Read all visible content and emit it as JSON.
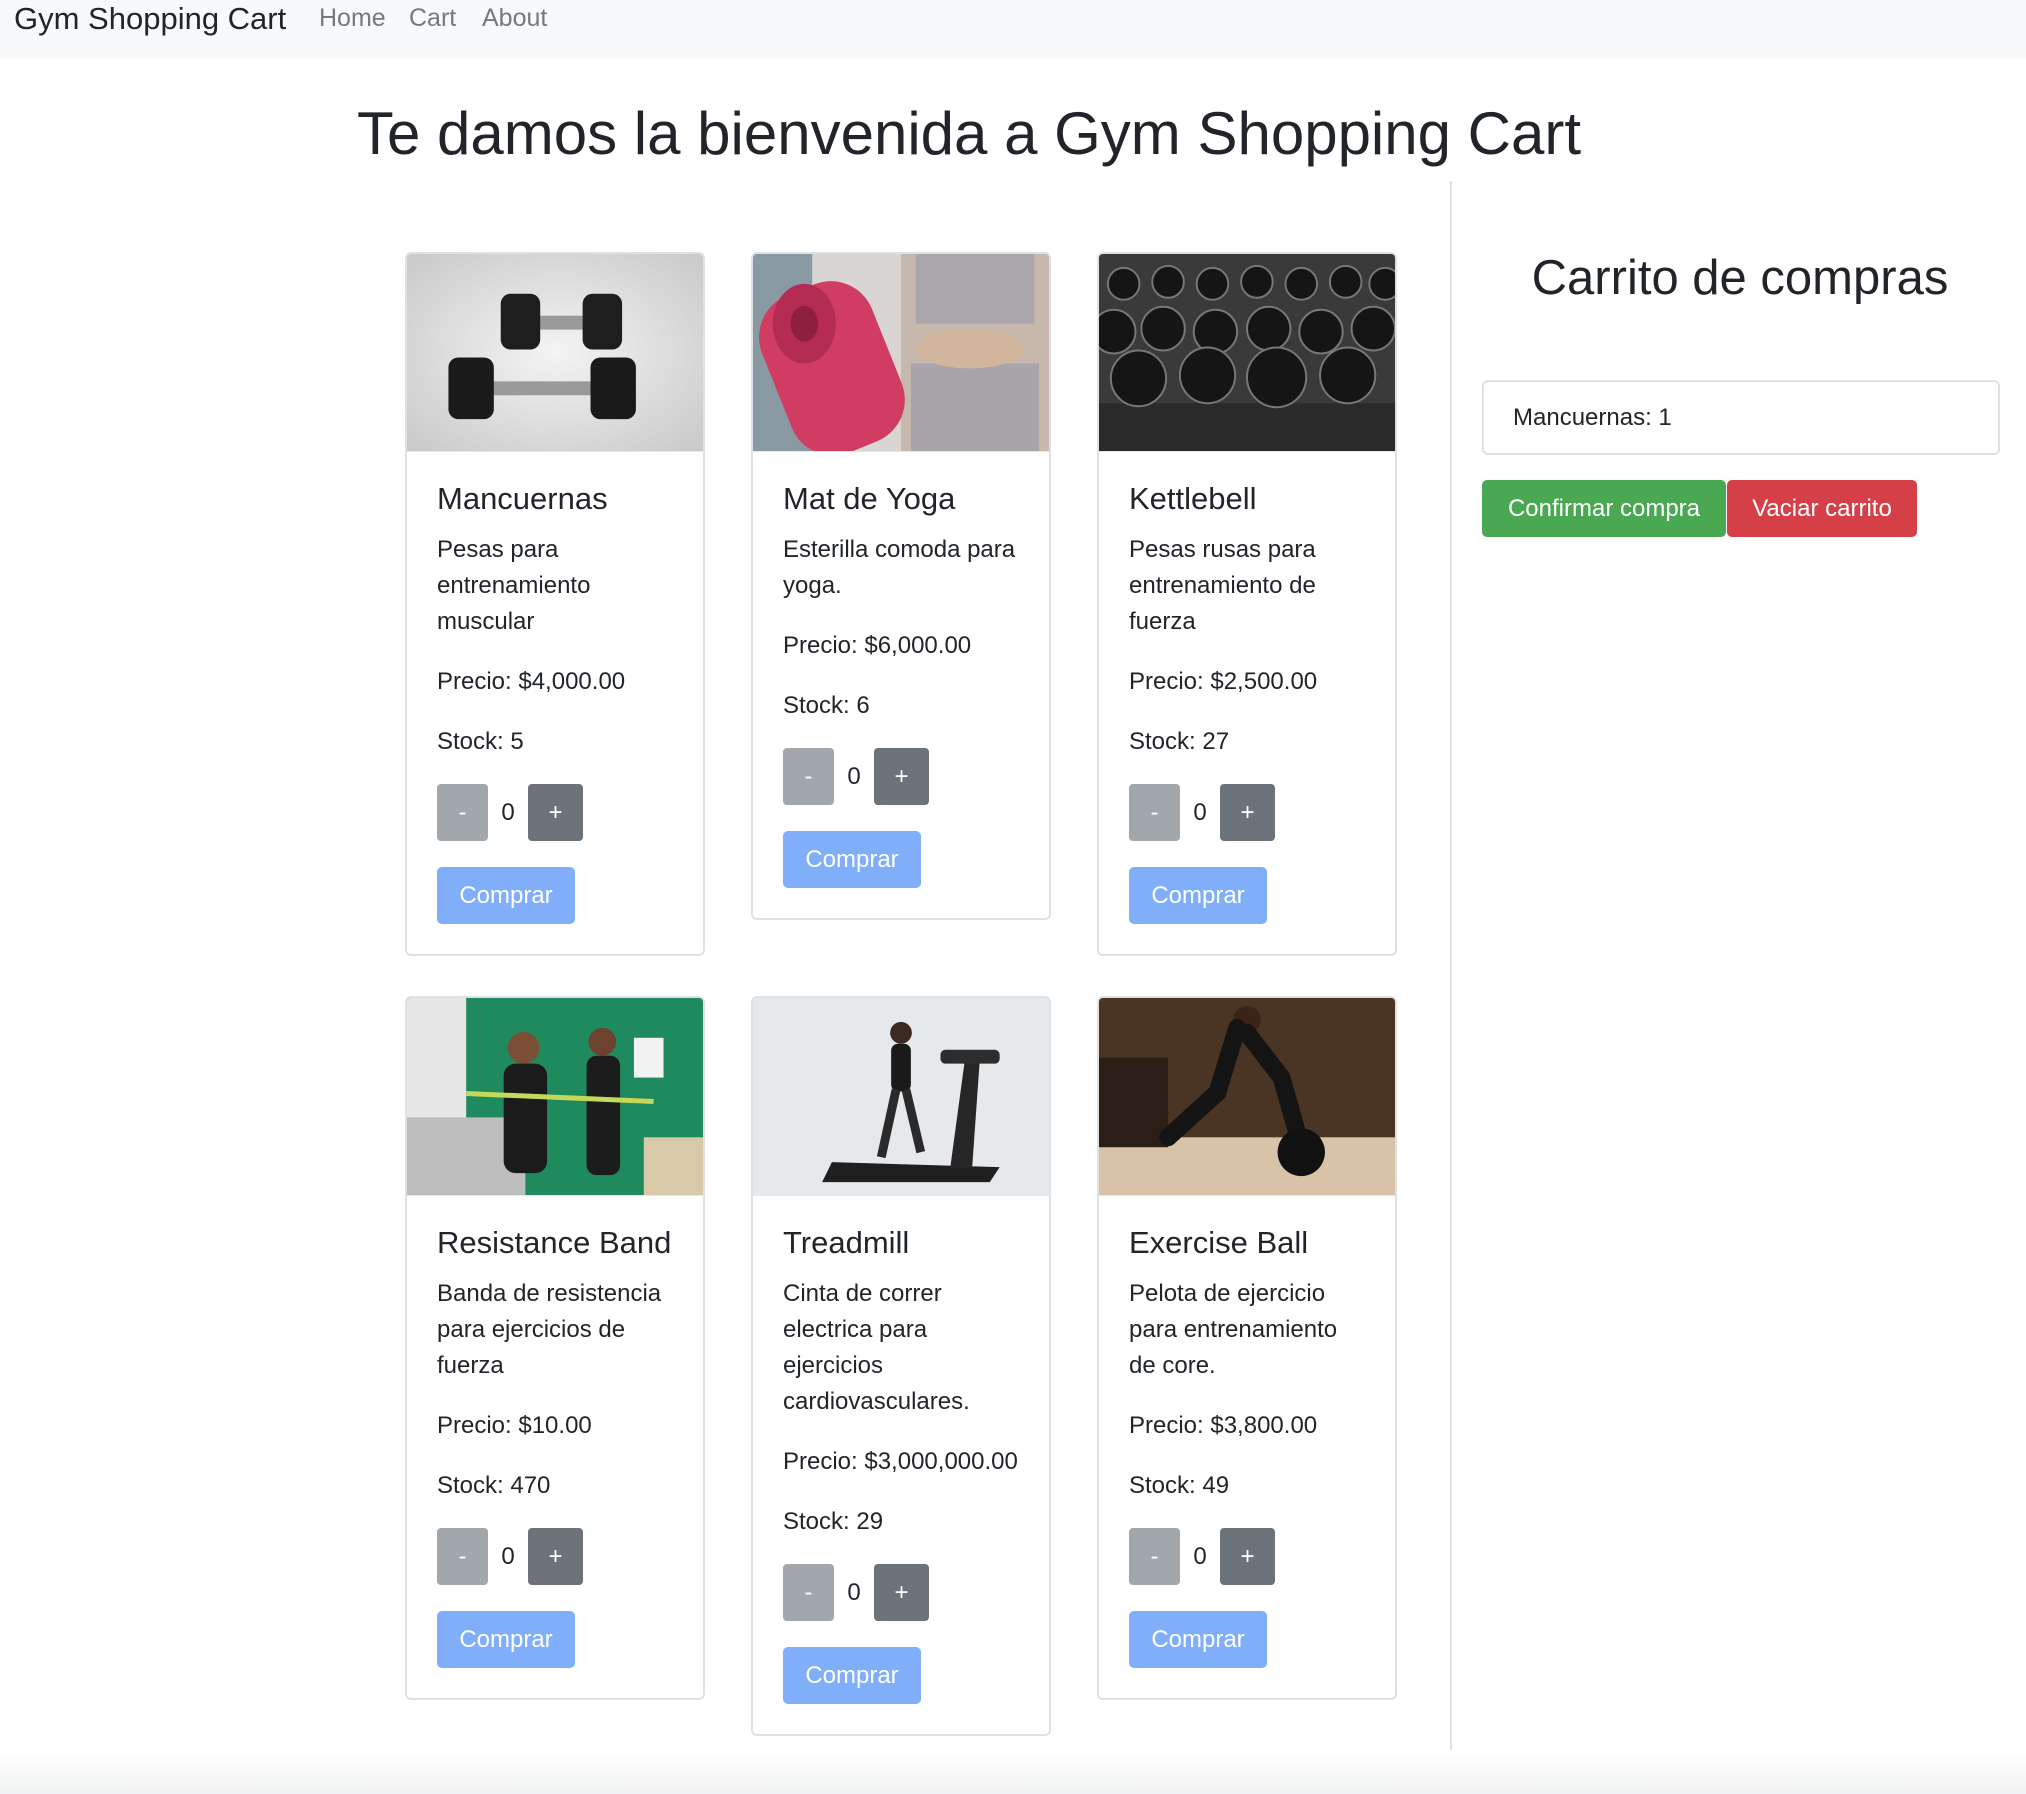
{
  "navbar": {
    "brand": "Gym Shopping Cart",
    "links": [
      "Home",
      "Cart",
      "About"
    ]
  },
  "page_title": "Te damos la bienvenida a Gym Shopping Cart",
  "products": [
    {
      "name": "Mancuernas",
      "description": "Pesas para entrenamiento muscular",
      "price": "Precio: $4,000.00",
      "stock": "Stock: 5",
      "qty": "0",
      "image_icon": "dumbbells-image"
    },
    {
      "name": "Mat de Yoga",
      "description": "Esterilla comoda para yoga.",
      "price": "Precio: $6,000.00",
      "stock": "Stock: 6",
      "qty": "0",
      "image_icon": "yoga-mat-image"
    },
    {
      "name": "Kettlebell",
      "description": "Pesas rusas para entrenamiento de fuerza",
      "price": "Precio: $2,500.00",
      "stock": "Stock: 27",
      "qty": "0",
      "image_icon": "kettlebells-image"
    },
    {
      "name": "Resistance Band",
      "description": "Banda de resistencia para ejercicios de fuerza",
      "price": "Precio: $10.00",
      "stock": "Stock: 470",
      "qty": "0",
      "image_icon": "resistance-band-image"
    },
    {
      "name": "Treadmill",
      "description": "Cinta de correr electrica para ejercicios cardiovasculares.",
      "price": "Precio: $3,000,000.00",
      "stock": "Stock: 29",
      "qty": "0",
      "image_icon": "treadmill-image"
    },
    {
      "name": "Exercise Ball",
      "description": "Pelota de ejercicio para entrenamiento de core.",
      "price": "Precio: $3,800.00",
      "stock": "Stock: 49",
      "qty": "0",
      "image_icon": "exercise-ball-image"
    }
  ],
  "buttons": {
    "minus": "-",
    "plus": "+",
    "buy": "Comprar"
  },
  "cart": {
    "title": "Carrito de compras",
    "items": [
      "Mancuernas: 1"
    ],
    "confirm_label": "Confirmar compra",
    "clear_label": "Vaciar carrito"
  },
  "colors": {
    "navbar_bg": "#f8f9fa",
    "primary_light": "#80aef8",
    "success": "#4aa852",
    "danger": "#d53f48",
    "secondary": "#6c737a",
    "secondary_light": "#a2a7ac"
  }
}
